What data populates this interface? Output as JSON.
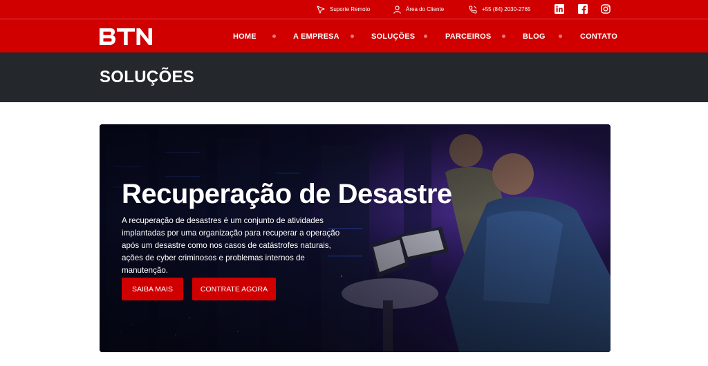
{
  "topbar": {
    "remote_support": "Suporte Remoto",
    "client_area": "Área do Cliente",
    "phone": "+55 (84) 2030-2765",
    "social": [
      "linkedin-icon",
      "facebook-icon",
      "instagram-icon"
    ]
  },
  "brand": {
    "logo_text": "BTN"
  },
  "nav": {
    "items": [
      "HOME",
      "A EMPRESA",
      "SOLUÇÕES",
      "PARCEIROS",
      "BLOG",
      "CONTATO"
    ]
  },
  "page": {
    "title": "SOLUÇÕES"
  },
  "hero": {
    "title": "Recuperação de Desastre",
    "description": "A recuperação de desastres é um conjunto de atividades implantadas por uma organização para recuperar a operação após um desastre como nos casos de catástrofes naturais, ações de cyber criminosos e problemas internos de manutenção.",
    "primary_button": "SAIBA MAIS",
    "secondary_button": "CONTRATE AGORA"
  },
  "colors": {
    "brand_red": "#d00000",
    "title_bar": "#24272b",
    "white": "#ffffff"
  }
}
